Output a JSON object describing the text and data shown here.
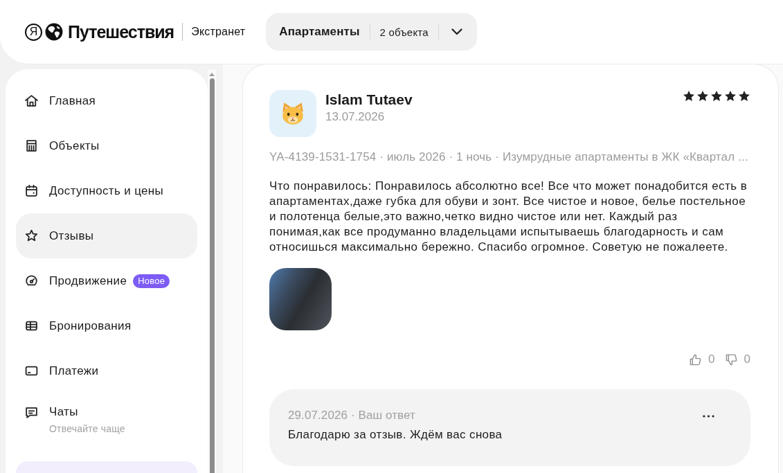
{
  "header": {
    "logo_mark": "Я",
    "brand": "Путешествия",
    "section": "Экстранет",
    "selector": {
      "title": "Апартаменты",
      "count": "2 объекта"
    }
  },
  "sidebar": {
    "items": [
      {
        "label": "Главная",
        "selected": false
      },
      {
        "label": "Объекты",
        "selected": false
      },
      {
        "label": "Доступность и цены",
        "selected": false
      },
      {
        "label": "Отзывы",
        "selected": true
      },
      {
        "label": "Продвижение",
        "badge": "Новое",
        "selected": false
      },
      {
        "label": "Бронирования",
        "selected": false
      },
      {
        "label": "Платежи",
        "selected": false
      },
      {
        "label": "Чаты",
        "subtitle": "Отвечайте чаще",
        "selected": false
      }
    ]
  },
  "review": {
    "author": "Islam Tutaev",
    "date": "13.07.2026",
    "stars": 5,
    "meta": "YA-4139-1531-1754 · июль 2026 · 1 ночь · Изумрудные апартаменты в ЖК «Квартал ...",
    "text": "Что понравилось: Понравилось абсолютно все! Все что может понадобится есть в апартаментах,даже губка для обуви и зонт. Все чистое и новое, белье постельное и полотенца белые,это важно,четко видно чистое или нет. Каждый раз понимая,как все продуманно владельцами испытываешь благодарность и сам относишься максимально бережно. Спасибо огромное. Советую не пожалеете.",
    "likes": "0",
    "dislikes": "0",
    "reply": {
      "meta": "29.07.2026 · Ваш ответ",
      "text": "Благодарю за отзыв. Ждём вас снова"
    }
  }
}
